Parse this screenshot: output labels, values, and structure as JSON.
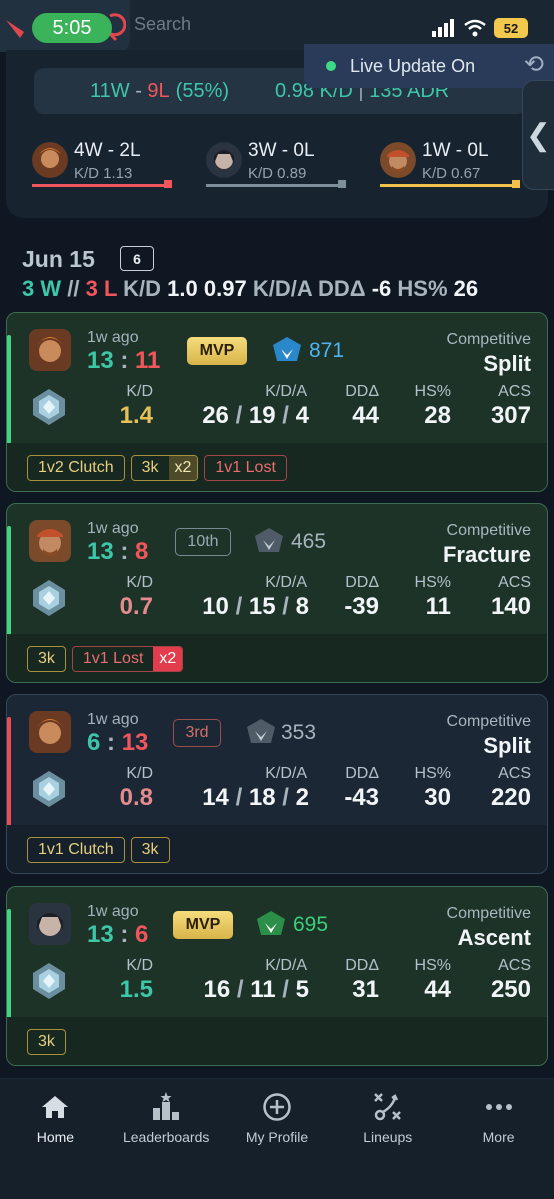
{
  "status_bar": {
    "time": "5:05",
    "search_placeholder": "Search",
    "battery": "52"
  },
  "live_update": {
    "label": "Live Update On"
  },
  "summary": {
    "wins": "11W",
    "dash": " - ",
    "losses": "9L",
    "pct": "(55%)",
    "kd": "0.98 K/D",
    "sep": " | ",
    "adr": "135 ADR",
    "agents": [
      {
        "record": "4W - 2L",
        "kd": "K/D 1.13",
        "color": "#f0565c"
      },
      {
        "record": "3W - 0L",
        "kd": "K/D 0.89",
        "color": "#7f8e9b"
      },
      {
        "record": "1W - 0L",
        "kd": "K/D 0.67",
        "color": "#f2c14a"
      }
    ]
  },
  "day": {
    "date": "Jun 15",
    "count": "6",
    "wins": "3 W",
    "sep": "//",
    "losses": "3 L",
    "kd_label": "K/D",
    "kd_value": "1.0",
    "kda_value": "0.97",
    "kda_label": "K/D/A",
    "dd_label": "DDΔ",
    "dd_value": "-6",
    "hs_label": "HS%",
    "hs_value": "26"
  },
  "labels": {
    "kd": "K/D",
    "kda": "K/D/A",
    "dd": "DDΔ",
    "hs": "HS%",
    "acs": "ACS",
    "mode": "Competitive",
    "slash": " / ",
    "colon": " : "
  },
  "matches": [
    {
      "ago": "1w ago",
      "score_us": "13",
      "score_them": "11",
      "badge": "MVP",
      "rr": "871",
      "map": "Split",
      "kd": "1.4",
      "k": "26",
      "d": "19",
      "a": "4",
      "dd": "44",
      "hs": "28",
      "acs": "307",
      "tags": [
        {
          "text": "1v2 Clutch"
        },
        {
          "text": "3k",
          "mult": "x2"
        },
        {
          "text": "1v1 Lost"
        }
      ]
    },
    {
      "ago": "1w ago",
      "score_us": "13",
      "score_them": "8",
      "badge": "10th",
      "rr": "465",
      "map": "Fracture",
      "kd": "0.7",
      "k": "10",
      "d": "15",
      "a": "8",
      "dd": "-39",
      "hs": "11",
      "acs": "140",
      "tags": [
        {
          "text": "3k"
        },
        {
          "text": "1v1 Lost",
          "mult": "x2"
        }
      ]
    },
    {
      "ago": "1w ago",
      "score_us": "6",
      "score_them": "13",
      "badge": "3rd",
      "rr": "353",
      "map": "Split",
      "kd": "0.8",
      "k": "14",
      "d": "18",
      "a": "2",
      "dd": "-43",
      "hs": "30",
      "acs": "220",
      "tags": [
        {
          "text": "1v1 Clutch"
        },
        {
          "text": "3k"
        }
      ]
    },
    {
      "ago": "1w ago",
      "score_us": "13",
      "score_them": "6",
      "badge": "MVP",
      "rr": "695",
      "map": "Ascent",
      "kd": "1.5",
      "k": "16",
      "d": "11",
      "a": "5",
      "dd": "31",
      "hs": "44",
      "acs": "250",
      "tags": [
        {
          "text": "3k"
        }
      ]
    }
  ],
  "nav": [
    {
      "label": "Home",
      "icon": "home-icon"
    },
    {
      "label": "Leaderboards",
      "icon": "leaderboard-icon"
    },
    {
      "label": "My Profile",
      "icon": "add-circle-icon"
    },
    {
      "label": "Lineups",
      "icon": "lineups-icon"
    },
    {
      "label": "More",
      "icon": "more-icon"
    }
  ]
}
